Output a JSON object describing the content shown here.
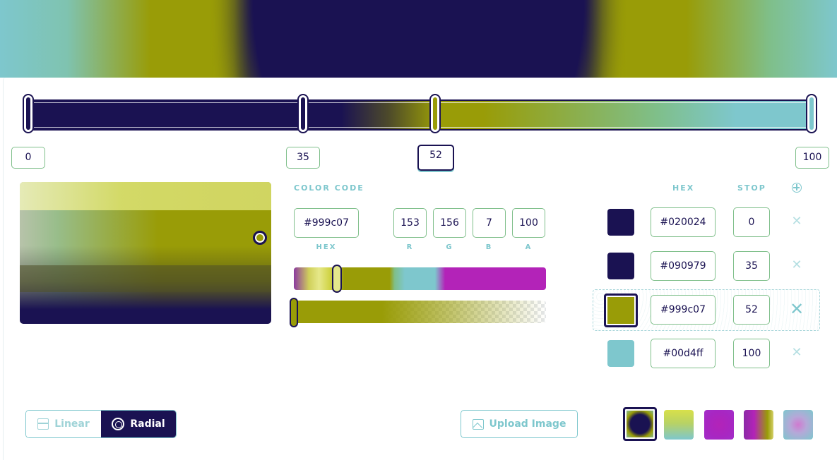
{
  "colors": {
    "navy": "#1a1252",
    "olive": "#999c07",
    "teal": "#7ec7cd",
    "magenta": "#b323b8"
  },
  "stop_positions": [
    "0",
    "35",
    "52",
    "100"
  ],
  "active_stop": "52",
  "color_code": {
    "title": "COLOR CODE",
    "hex": "#999c07",
    "r": "153",
    "g": "156",
    "b": "7",
    "a": "100",
    "labels": {
      "hex": "HEX",
      "r": "R",
      "g": "G",
      "b": "B",
      "a": "A"
    }
  },
  "stops_table": {
    "header_hex": "HEX",
    "header_stop": "STOP",
    "rows": [
      {
        "hex": "#020024",
        "stop": "0",
        "swatch": "#1a1252"
      },
      {
        "hex": "#090979",
        "stop": "35",
        "swatch": "#1a1252"
      },
      {
        "hex": "#999c07",
        "stop": "52",
        "swatch": "#999c07"
      },
      {
        "hex": "#00d4ff",
        "stop": "100",
        "swatch": "#7ec7cd"
      }
    ],
    "remove_icon": "✕",
    "add_icon": "plus-circle-icon"
  },
  "mode": {
    "linear_label": "Linear",
    "radial_label": "Radial",
    "selected": "Radial"
  },
  "upload": {
    "label": "Upload Image"
  },
  "presets": [
    "radial-navy-olive",
    "olive-teal",
    "magenta-radial",
    "magenta-olive",
    "teal-magenta"
  ]
}
